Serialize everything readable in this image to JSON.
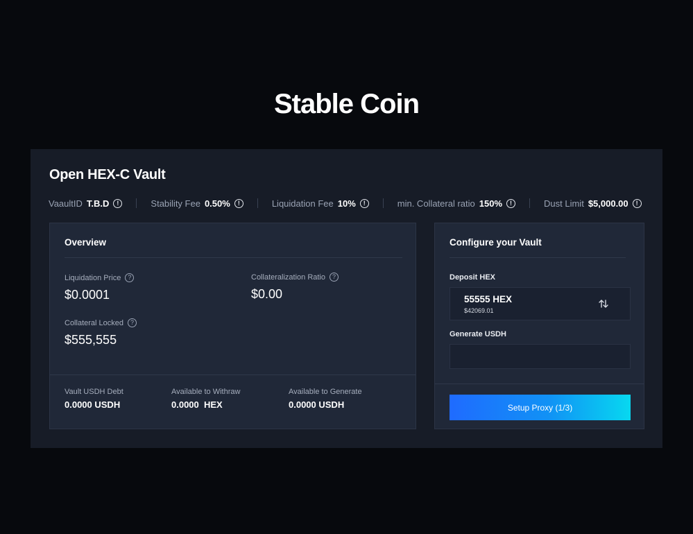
{
  "page": {
    "title": "Stable Coin"
  },
  "vault": {
    "title": "Open HEX-C Vault",
    "stats": [
      {
        "label": "VaaultID",
        "value": "T.B.D",
        "icon": "info-icon"
      },
      {
        "label": "Stability Fee",
        "value": "0.50%",
        "icon": "info-icon"
      },
      {
        "label": "Liquidation Fee",
        "value": "10%",
        "icon": "info-icon"
      },
      {
        "label": "min. Collateral ratio",
        "value": "150%",
        "icon": "info-icon"
      },
      {
        "label": "Dust Limit",
        "value": "$5,000.00",
        "icon": "info-icon"
      }
    ]
  },
  "overview": {
    "title": "Overview",
    "liquidation_price": {
      "label": "Liquidation Price",
      "value": "$0.0001"
    },
    "collateralization_ratio": {
      "label": "Collateralization Ratio",
      "value": "$0.00"
    },
    "collateral_locked": {
      "label": "Collateral Locked",
      "value": "$555,555"
    },
    "footer": [
      {
        "label": "Vault USDH Debt",
        "value": "0.0000 USDH"
      },
      {
        "label": "Available to Withraw",
        "value": "0.0000  HEX"
      },
      {
        "label": "Available to Generate",
        "value": "0.0000 USDH"
      }
    ]
  },
  "configure": {
    "title": "Configure your Vault",
    "deposit_label": "Deposit HEX",
    "deposit_amount": "55555 HEX",
    "deposit_usd": "$42069.01",
    "generate_label": "Generate USDH",
    "generate_value": "",
    "button_label": "Setup Proxy (1/3)"
  },
  "colors": {
    "background": "#07090d",
    "card": "#171c27",
    "panel": "#202838",
    "button_gradient_start": "#1f6bff",
    "button_gradient_end": "#07d8f0"
  }
}
